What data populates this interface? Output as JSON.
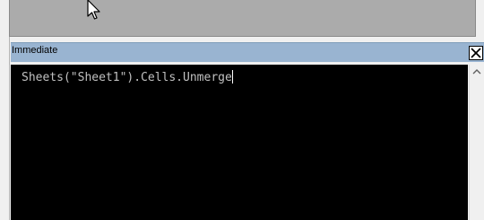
{
  "colors": {
    "code_area_background": "#ababab",
    "title_bar_background": "#99b4d1",
    "editor_background": "#000000",
    "code_text": "#c0c0c0"
  },
  "icons": {
    "close": "close-icon",
    "scroll_up": "scroll-up-arrow-icon",
    "mouse_pointer": "mouse-pointer-icon"
  },
  "immediate_window": {
    "title": "Immediate",
    "code_line": "Sheets(\"Sheet1\").Cells.Unmerge"
  }
}
